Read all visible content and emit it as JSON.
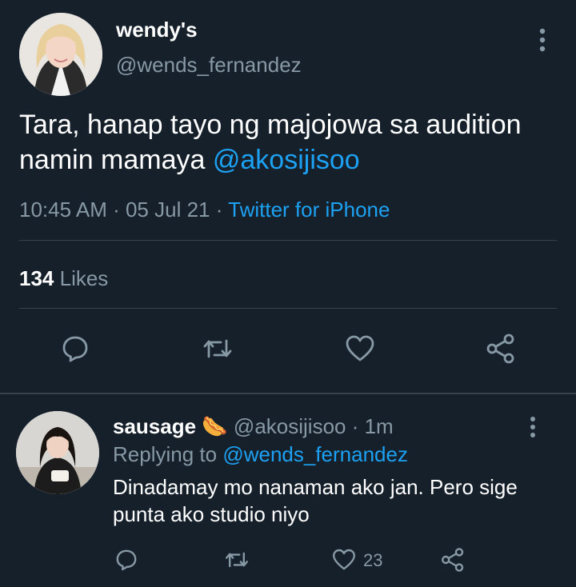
{
  "tweet": {
    "display_name": "wendy's",
    "handle": "@wends_fernandez",
    "text_before": "Tara, hanap tayo ng majojowa sa audition namin mamaya ",
    "mention": "@akosijisoo",
    "time": "10:45 AM",
    "sep1": " · ",
    "date": "05 Jul 21",
    "sep2": " · ",
    "source": "Twitter for iPhone",
    "likes_count": "134",
    "likes_label": " Likes"
  },
  "reply": {
    "display_name": "sausage",
    "emoji": "🌭",
    "handle": "@akosijisoo",
    "time": " · 1m",
    "replying_label": "Replying to ",
    "replying_to": "@wends_fernandez",
    "text": "Dinadamay mo nanaman ako jan. Pero sige punta ako studio niyo",
    "like_count": "23"
  },
  "icons": {
    "reply": "comment-icon",
    "retweet": "retweet-icon",
    "like": "heart-icon",
    "share": "share-icon",
    "more": "more-vertical-icon"
  },
  "colors": {
    "background": "#15202b",
    "accent": "#1da1f2",
    "secondary_text": "#8899a6",
    "divider": "#38444d"
  }
}
